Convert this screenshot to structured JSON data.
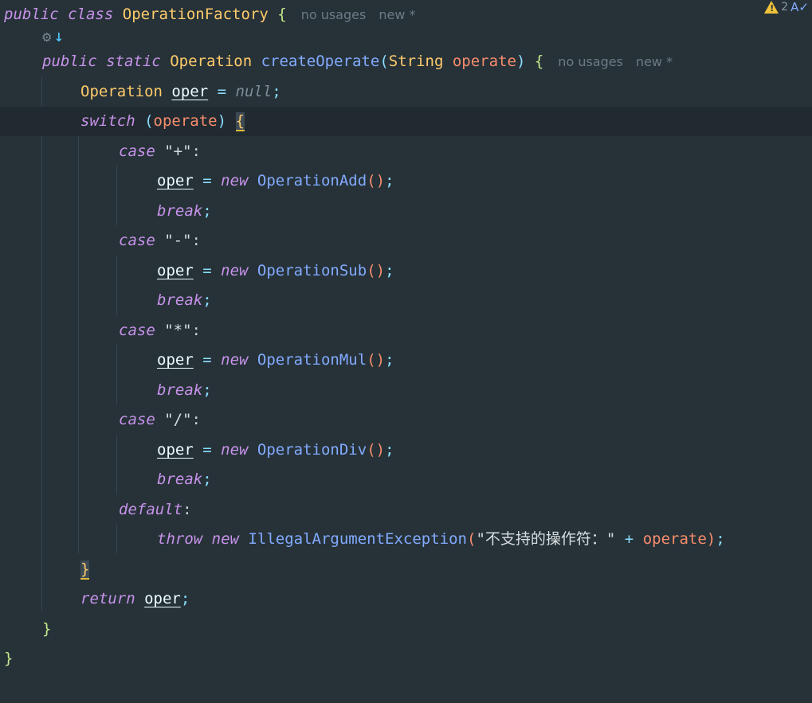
{
  "editor": {
    "warnings_count": "2",
    "icons": {
      "warning": "warning-triangle-icon",
      "spellcheck": "spellcheck-icon",
      "gutter_inherit": "implementation-gutter-icon"
    },
    "inlay_hints": {
      "class_usages": "no usages",
      "class_new": "new *",
      "method_usages": "no usages",
      "method_new": "new *"
    },
    "code": {
      "l1_public": "public",
      "l1_class": "class",
      "l1_name": "OperationFactory",
      "l1_brace": "{",
      "l3_public": "public",
      "l3_static": "static",
      "l3_type": "Operation",
      "l3_method": "createOperate",
      "l3_lparen": "(",
      "l3_ptype": "String",
      "l3_pname": "operate",
      "l3_rparen": ")",
      "l3_brace": "{",
      "l4_type": "Operation",
      "l4_var": "oper",
      "l4_eq": "=",
      "l4_null": "null",
      "l4_semi": ";",
      "l5_switch": "switch",
      "l5_lparen": "(",
      "l5_arg": "operate",
      "l5_rparen": ")",
      "l5_brace": "{",
      "case_kw": "case",
      "c1_label": "\"+\"",
      "c2_label": "\"-\"",
      "c3_label": "\"*\"",
      "c4_label": "\"/\"",
      "colon": ":",
      "var": "oper",
      "eq": "=",
      "new_kw": "new",
      "c1_cls": "OperationAdd",
      "c2_cls": "OperationSub",
      "c3_cls": "OperationMul",
      "c4_cls": "OperationDiv",
      "parens": "()",
      "semi": ";",
      "break_kw": "break",
      "default_kw": "default",
      "throw_kw": "throw",
      "exc_cls": "IllegalArgumentException",
      "exc_lparen": "(",
      "exc_msg": "\"不支持的操作符：\"",
      "plus": "+",
      "exc_arg": "operate",
      "exc_rparen": ")",
      "switch_close": "}",
      "return_kw": "return",
      "return_var": "oper",
      "method_close": "}",
      "class_close": "}"
    }
  }
}
